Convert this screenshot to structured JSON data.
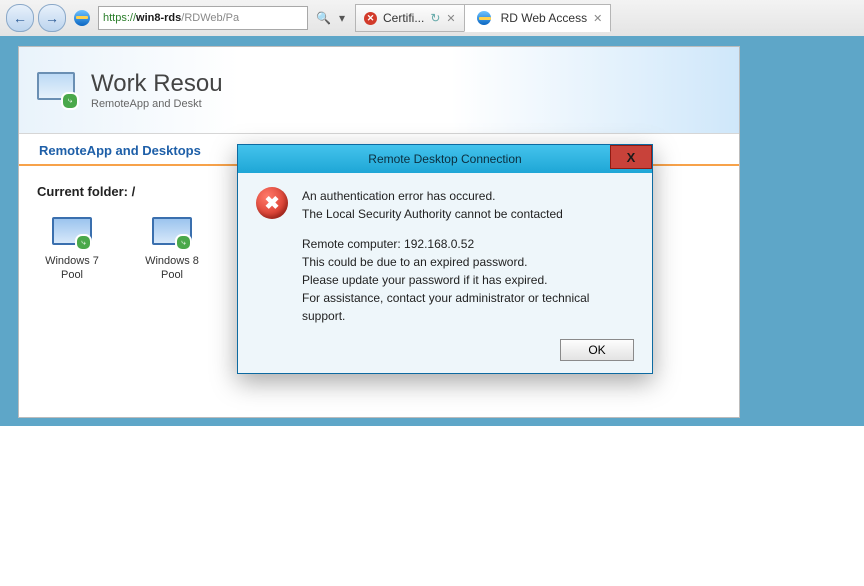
{
  "browser": {
    "address": {
      "scheme": "https://",
      "host": "win8-rds",
      "path": "/RDWeb/Pa"
    },
    "tabs": [
      {
        "label": "Certifi...",
        "type": "error"
      },
      {
        "label": "RD Web Access",
        "type": "active"
      }
    ]
  },
  "page": {
    "title": "Work Resou",
    "subtitle": "RemoteApp and Deskt",
    "tab_label": "RemoteApp and Desktops",
    "folder_label": "Current folder: /",
    "apps": [
      {
        "name": "Windows 7 Pool"
      },
      {
        "name": "Windows 8 Pool"
      }
    ]
  },
  "dialog": {
    "title": "Remote Desktop Connection",
    "line1": "An authentication error has occured.",
    "line2": "The Local Security Authority cannot be contacted",
    "remote_label": "Remote computer: ",
    "remote_value": "192.168.0.52",
    "line3": "This could be due to an expired password.",
    "line4": "Please update your password if it has expired.",
    "line5": "For assistance, contact your administrator or technical support.",
    "ok": "OK",
    "close": "X"
  }
}
